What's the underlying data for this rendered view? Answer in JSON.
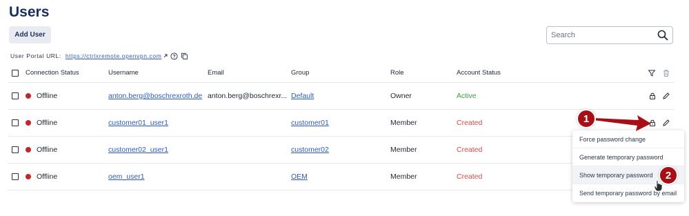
{
  "page": {
    "title": "Users"
  },
  "toolbar": {
    "add_user_label": "Add User"
  },
  "search": {
    "placeholder": "Search"
  },
  "portal": {
    "label": "User Portal URL:",
    "url": "https://ctrlxremote.openvpn.com"
  },
  "table": {
    "headers": {
      "connection_status": "Connection Status",
      "username": "Username",
      "email": "Email",
      "group": "Group",
      "role": "Role",
      "account_status": "Account Status"
    },
    "rows": [
      {
        "status": "Offline",
        "username": "anton.berg@boschrexroth.de",
        "email": "anton.berg@boschrexr...",
        "group": "Default",
        "role": "Owner",
        "account_status": "Active"
      },
      {
        "status": "Offline",
        "username": "customer01_user1",
        "email": "",
        "group": "customer01",
        "role": "Member",
        "account_status": "Created"
      },
      {
        "status": "Offline",
        "username": "customer02_user1",
        "email": "",
        "group": "customer02",
        "role": "Member",
        "account_status": "Created"
      },
      {
        "status": "Offline",
        "username": "oem_user1",
        "email": "",
        "group": "OEM",
        "role": "Member",
        "account_status": "Created"
      }
    ]
  },
  "menu": {
    "items": [
      {
        "label": "Force password change"
      },
      {
        "label": "Generate temporary password"
      },
      {
        "label": "Show temporary password"
      },
      {
        "label": "Send temporary password by email"
      }
    ]
  },
  "markers": {
    "one": "1",
    "two": "2"
  },
  "colors": {
    "accent": "#2d5bb9",
    "offline": "#c0272d",
    "active": "#3a9a44",
    "created": "#d24b4b",
    "marker": "#a50f15"
  }
}
